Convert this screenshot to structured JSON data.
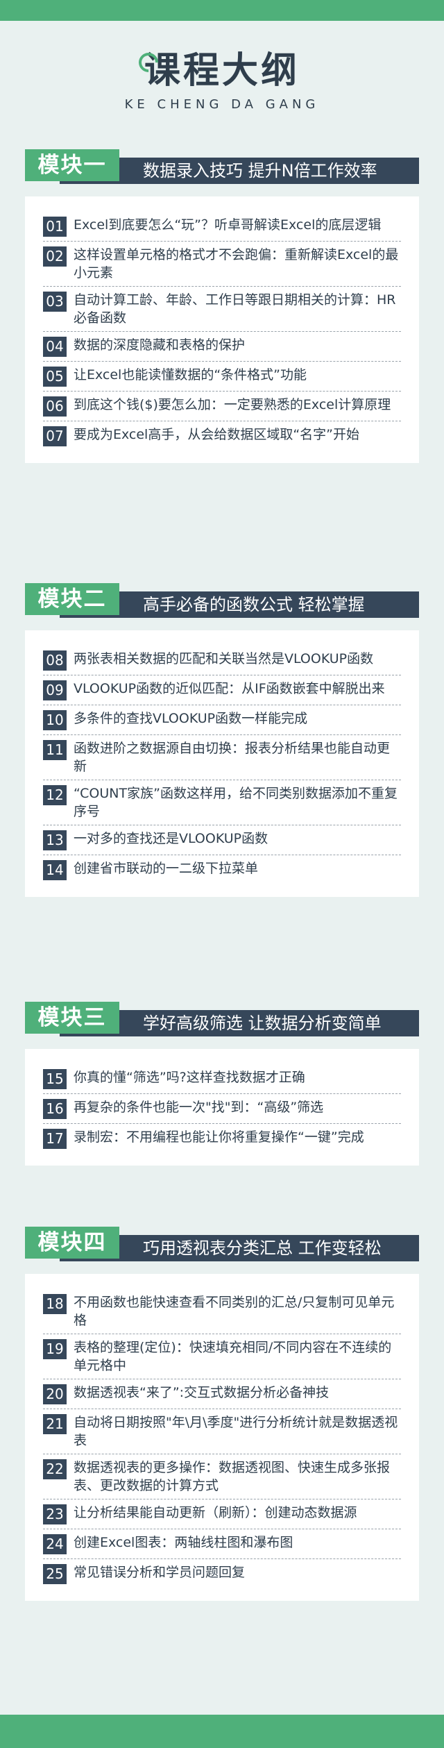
{
  "title": "课程大纲",
  "subtitle": "KE CHENG DA GANG",
  "modules": [
    {
      "badge": "模块一",
      "heading": "数据录入技巧 提升N倍工作效率",
      "items": [
        {
          "num": "01",
          "text": "Excel到底要怎么“玩”？听卓哥解读Excel的底层逻辑"
        },
        {
          "num": "02",
          "text": "这样设置单元格的格式才不会跑偏：重新解读Excel的最小元素"
        },
        {
          "num": "03",
          "text": "自动计算工龄、年龄、工作日等跟日期相关的计算：HR必备函数"
        },
        {
          "num": "04",
          "text": "数据的深度隐藏和表格的保护"
        },
        {
          "num": "05",
          "text": "让Excel也能读懂数据的“条件格式”功能"
        },
        {
          "num": "06",
          "text": "到底这个钱($)要怎么加：一定要熟悉的Excel计算原理"
        },
        {
          "num": "07",
          "text": "要成为Excel高手，从会给数据区域取“名字”开始"
        }
      ]
    },
    {
      "badge": "模块二",
      "heading": "高手必备的函数公式 轻松掌握",
      "items": [
        {
          "num": "08",
          "text": "两张表相关数据的匹配和关联当然是VLOOKUP函数"
        },
        {
          "num": "09",
          "text": "VLOOKUP函数的近似匹配：从IF函数嵌套中解脱出来"
        },
        {
          "num": "10",
          "text": "多条件的查找VLOOKUP函数一样能完成"
        },
        {
          "num": "11",
          "text": "函数进阶之数据源自由切换：报表分析结果也能自动更新"
        },
        {
          "num": "12",
          "text": "“COUNT家族”函数这样用，给不同类别数据添加不重复序号"
        },
        {
          "num": "13",
          "text": "一对多的查找还是VLOOKUP函数"
        },
        {
          "num": "14",
          "text": "创建省市联动的一二级下拉菜单"
        }
      ]
    },
    {
      "badge": "模块三",
      "heading": "学好高级筛选 让数据分析变简单",
      "items": [
        {
          "num": "15",
          "text": "你真的懂“筛选”吗?这样查找数据才正确"
        },
        {
          "num": "16",
          "text": "再复杂的条件也能一次\"找\"到：“高级”筛选"
        },
        {
          "num": "17",
          "text": "录制宏：不用编程也能让你将重复操作“一键”完成"
        }
      ]
    },
    {
      "badge": "模块四",
      "heading": "巧用透视表分类汇总 工作变轻松",
      "items": [
        {
          "num": "18",
          "text": "不用函数也能快速查看不同类别的汇总/只复制可见单元格"
        },
        {
          "num": "19",
          "text": "表格的整理(定位)：快速填充相同/不同内容在不连续的单元格中"
        },
        {
          "num": "20",
          "text": "数据透视表“来了”:交互式数据分析必备神技"
        },
        {
          "num": "21",
          "text": "自动将日期按照\"年\\月\\季度\"进行分析统计就是数据透视表"
        },
        {
          "num": "22",
          "text": "数据透视表的更多操作：数据透视图、快速生成多张报表、更改数据的计算方式"
        },
        {
          "num": "23",
          "text": "让分析结果能自动更新（刷新）：创建动态数据源"
        },
        {
          "num": "24",
          "text": "创建Excel图表：两轴线柱图和瀑布图"
        },
        {
          "num": "25",
          "text": "常见错误分析和学员问题回复"
        }
      ]
    }
  ]
}
